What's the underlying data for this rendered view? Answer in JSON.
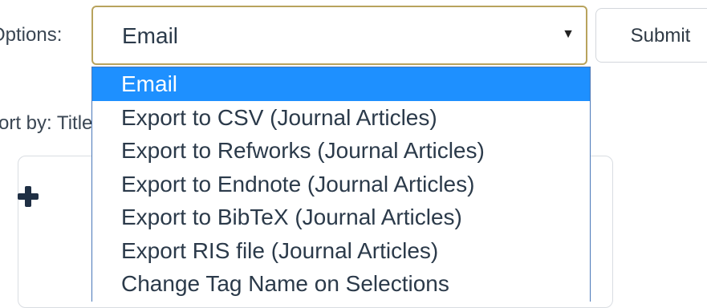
{
  "form": {
    "options_label": "Options:",
    "sort_label": "Sort by: Title ,"
  },
  "select": {
    "value": "Email",
    "caret_icon": "triangle-down-icon",
    "border_color": "#b8a35d"
  },
  "submit": {
    "label": "Submit"
  },
  "dropdown": {
    "highlight_color": "#1e90ff",
    "options": [
      {
        "label": "Email",
        "selected": true
      },
      {
        "label": "Export to CSV (Journal Articles)",
        "selected": false
      },
      {
        "label": "Export to Refworks (Journal Articles)",
        "selected": false
      },
      {
        "label": "Export to Endnote (Journal Articles)",
        "selected": false
      },
      {
        "label": "Export to BibTeX (Journal Articles)",
        "selected": false
      },
      {
        "label": "Export RIS file (Journal Articles)",
        "selected": false
      },
      {
        "label": "Change Tag Name on Selections",
        "selected": false
      }
    ]
  },
  "panel": {
    "expand_icon": "plus-icon"
  }
}
